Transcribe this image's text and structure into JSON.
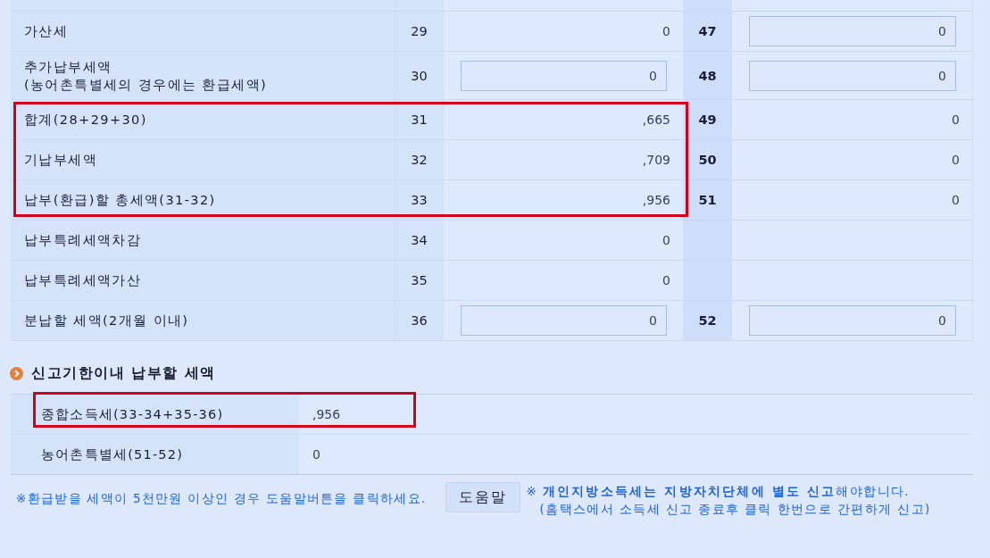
{
  "main_table": {
    "groups": [
      {
        "highlighted": false,
        "rows": [
          {
            "label": [
              "가산세"
            ],
            "line": "29",
            "amount": {
              "kind": "text",
              "value": "0"
            },
            "line_2": "47",
            "amount_2": {
              "kind": "input",
              "value": "0"
            }
          },
          {
            "label": [
              "추가납부세액",
              "(농어촌특별세의 경우에는 환급세액)"
            ],
            "line": "30",
            "amount": {
              "kind": "input",
              "value": "0"
            },
            "line_2": "48",
            "amount_2": {
              "kind": "input",
              "value": "0"
            }
          }
        ]
      },
      {
        "highlighted": true,
        "rows": [
          {
            "label": [
              "합계(28+29+30)"
            ],
            "line": "31",
            "amount": {
              "kind": "text",
              "value": ",665"
            },
            "line_2": "49",
            "amount_2": {
              "kind": "text",
              "value": "0"
            }
          },
          {
            "label": [
              "기납부세액"
            ],
            "line": "32",
            "amount": {
              "kind": "text",
              "value": ",709"
            },
            "line_2": "50",
            "amount_2": {
              "kind": "text",
              "value": "0"
            }
          },
          {
            "label": [
              "납부(환급)할 총세액(31-32)"
            ],
            "line": "33",
            "amount": {
              "kind": "text",
              "value": ",956"
            },
            "line_2": "51",
            "amount_2": {
              "kind": "text",
              "value": "0"
            }
          }
        ]
      },
      {
        "highlighted": false,
        "rows": [
          {
            "label": [
              "납부특례세액차감"
            ],
            "line": "34",
            "amount": {
              "kind": "text",
              "value": "0"
            }
          },
          {
            "label": [
              "납부특례세액가산"
            ],
            "line": "35",
            "amount": {
              "kind": "text",
              "value": "0"
            }
          },
          {
            "label": [
              "분납할 세액(2개월 이내)"
            ],
            "line": "36",
            "amount": {
              "kind": "input",
              "value": "0"
            },
            "line_2": "52",
            "amount_2": {
              "kind": "input",
              "value": "0"
            }
          }
        ]
      }
    ]
  },
  "due_section": {
    "title": "신고기한이내 납부할 세액",
    "rows": [
      {
        "label": "종합소득세(33-34+35-36)",
        "value": ",956",
        "highlighted": true
      },
      {
        "label": "농어촌특별세(51-52)",
        "value": "0",
        "highlighted": false
      }
    ]
  },
  "footer": {
    "refund_note": "※환급받을 세액이 5천만원 이상인 경우 도움말버튼을 클릭하세요.",
    "help_button": "도움말",
    "local_tax_note": [
      "※ **개인지방소득세는 지방자치단체에 별도 신고**해야합니다.",
      "(홈택스에서 소득세 신고 종료후 클릭 한번으로 간편하게 신고)"
    ]
  }
}
